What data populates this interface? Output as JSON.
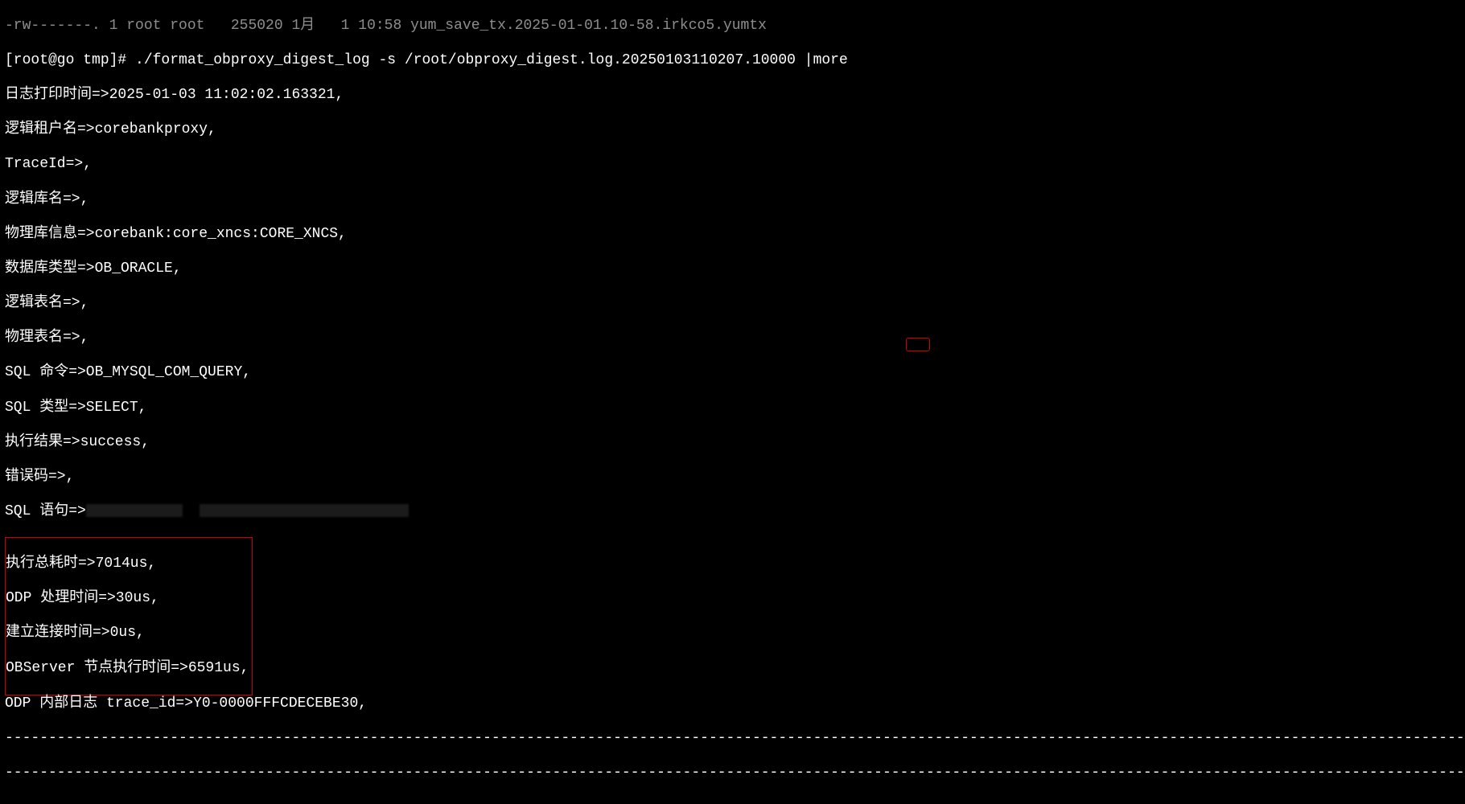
{
  "terminal": {
    "top_partial_line": "-rw-------. 1 root root   255020 1月   1 10:58 yum_save_tx.2025-01-01.10-58.irkco5.yumtx",
    "prompt": "[root@go tmp]# ",
    "command": "./format_obproxy_digest_log -s /root/obproxy_digest.log.20250103110207.10000 |more",
    "lines": [
      "日志打印时间=>2025-01-03 11:02:02.163321,",
      "逻辑租户名=>corebankproxy,",
      "TraceId=>,",
      "逻辑库名=>,",
      "物理库信息=>corebank:core_xncs:CORE_XNCS,",
      "数据库类型=>OB_ORACLE,",
      "逻辑表名=>,",
      "物理表名=>,",
      "SQL 命令=>OB_MYSQL_COM_QUERY,",
      "SQL 类型=>SELECT,",
      "执行结果=>success,",
      "错误码=>,"
    ],
    "sql_statement_label": "SQL 语句=>",
    "boxed_lines": [
      "执行总耗时=>7014us,",
      "ODP 处理时间=>30us,",
      "建立连接时间=>0us,",
      "OBServer 节点执行时间=>6591us,"
    ],
    "odp_trace": "ODP 内部日志 trace_id=>Y0-0000FFFCDECEBE30,",
    "separator": "--------------------------------------------------------------------------------------------------------------------------------------------------------------------------------------------------"
  }
}
